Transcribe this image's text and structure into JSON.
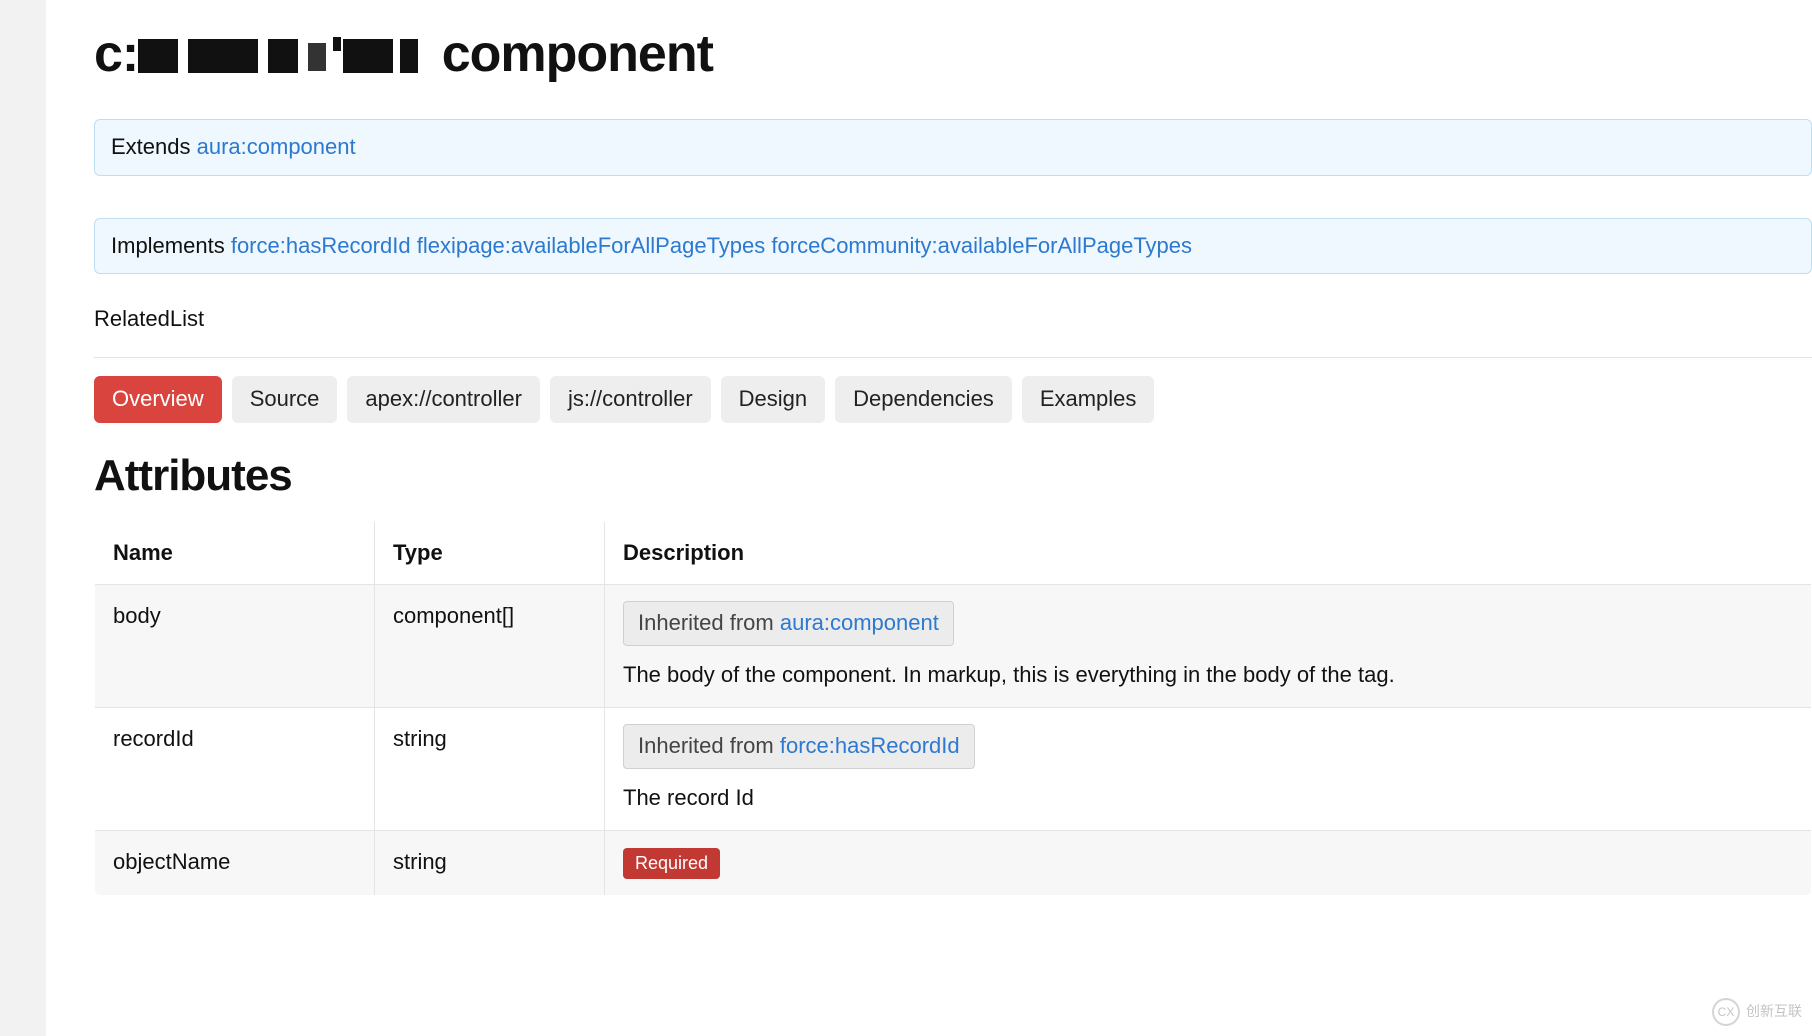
{
  "header": {
    "prefix": "c:",
    "suffix": " component"
  },
  "extends": {
    "label": "Extends ",
    "link": "aura:component"
  },
  "implements": {
    "label": "Implements ",
    "links": [
      "force:hasRecordId",
      "flexipage:availableForAllPageTypes",
      "forceCommunity:availableForAllPageTypes"
    ]
  },
  "description": "RelatedList",
  "tabs": [
    {
      "label": "Overview",
      "active": true
    },
    {
      "label": "Source",
      "active": false
    },
    {
      "label": "apex://controller",
      "active": false
    },
    {
      "label": "js://controller",
      "active": false
    },
    {
      "label": "Design",
      "active": false
    },
    {
      "label": "Dependencies",
      "active": false
    },
    {
      "label": "Examples",
      "active": false
    }
  ],
  "attributes": {
    "heading": "Attributes",
    "columns": [
      "Name",
      "Type",
      "Description"
    ],
    "inherited_label": "Inherited from ",
    "required_label": "Required",
    "rows": [
      {
        "name": "body",
        "type": "component[]",
        "inherited_from": "aura:component",
        "desc": "The body of the component. In markup, this is everything in the body of the tag."
      },
      {
        "name": "recordId",
        "type": "string",
        "inherited_from": "force:hasRecordId",
        "desc": "The record Id"
      },
      {
        "name": "objectName",
        "type": "string",
        "required": true,
        "desc": ""
      }
    ]
  },
  "watermark": "创新互联"
}
